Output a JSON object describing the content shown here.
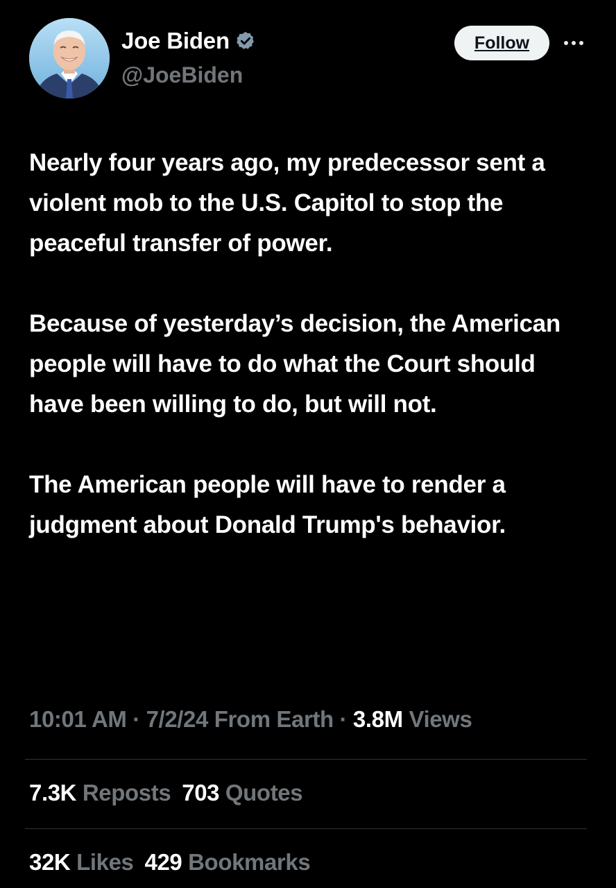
{
  "author": {
    "display_name": "Joe Biden",
    "handle": "@JoeBiden",
    "verified_icon": "verified-badge-icon",
    "verified_color": "#829aab"
  },
  "actions": {
    "follow_label": "Follow",
    "more_icon": "more-horizontal-icon"
  },
  "tweet": {
    "paragraphs": [
      "Nearly four years ago, my predecessor sent a violent mob to the U.S. Capitol to stop the peaceful transfer of power.",
      "Because of yesterday’s decision, the American people will have to do what the Court should have been willing to do, but will not.",
      "The American people will have to render a judgment about Donald Trump's behavior."
    ]
  },
  "meta": {
    "time": "10:01 AM",
    "sep1": " · ",
    "date": "7/2/24",
    "source": " From Earth",
    "sep2": " · ",
    "views_count": "3.8M",
    "views_label": " Views"
  },
  "stats": {
    "reposts_count": "7.3K",
    "reposts_label": " Reposts",
    "quotes_count": "703",
    "quotes_label": " Quotes",
    "likes_count": "32K",
    "likes_label": " Likes",
    "bookmarks_count": "429",
    "bookmarks_label": " Bookmarks"
  },
  "colors": {
    "background": "#000000",
    "text": "#ffffff",
    "secondary_text": "#71767b",
    "divider": "#2f3336",
    "follow_bg": "#eff3f4"
  }
}
